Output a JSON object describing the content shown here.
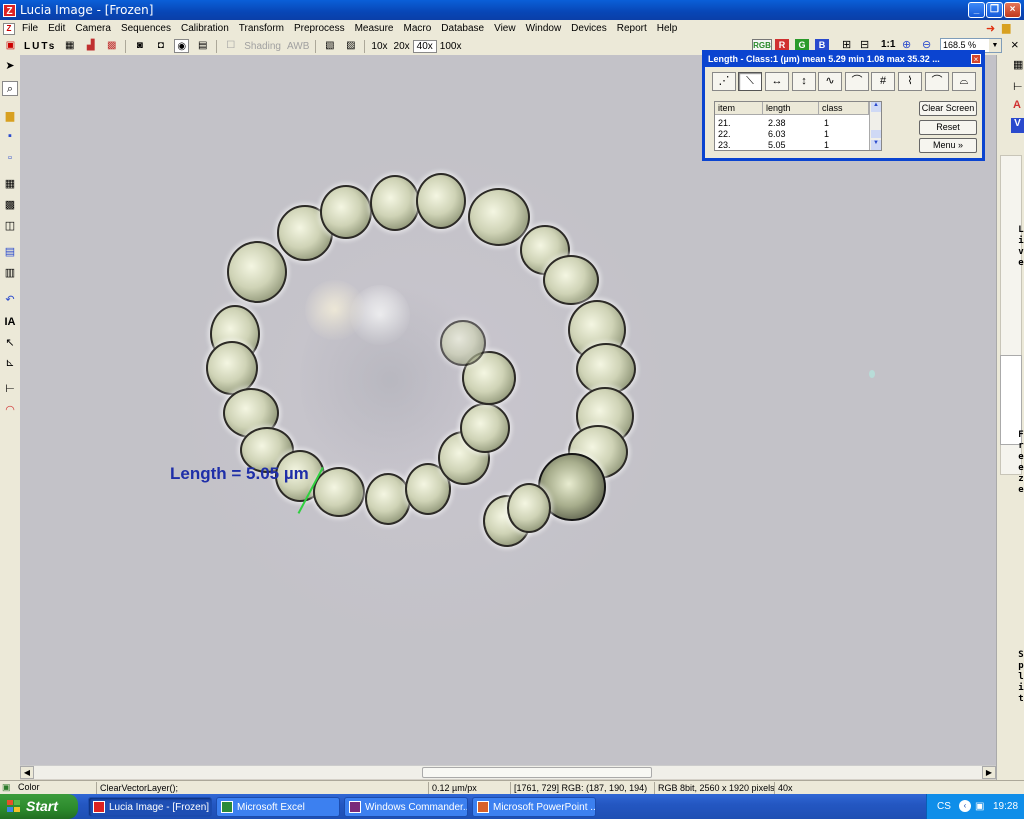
{
  "window": {
    "title": "Lucia Image  - [Frozen]",
    "app_icon": "lucia-z-icon"
  },
  "menu": [
    "File",
    "Edit",
    "Camera",
    "Sequences",
    "Calibration",
    "Transform",
    "Preprocess",
    "Measure",
    "Macro",
    "Database",
    "View",
    "Window",
    "Devices",
    "Report",
    "Help"
  ],
  "toolbar": {
    "luts_label": "LUTs",
    "shading_label": "Shading",
    "awb_label": "AWB",
    "magnifications": [
      "10x",
      "20x",
      "40x",
      "100x"
    ],
    "selected_magnification": "40x",
    "rgb_buttons": [
      "R",
      "G",
      "B"
    ],
    "zoom_ratio_label": "1:1",
    "zoom_value": "168.5 %"
  },
  "measure_window": {
    "title": "Length - Class:1  (µm)   mean 5.29  min 1.08  max 35.32  ...",
    "columns": [
      "item",
      "length",
      "class"
    ],
    "rows": [
      {
        "item": "21.",
        "length": "2.38",
        "class": "1"
      },
      {
        "item": "22.",
        "length": "6.03",
        "class": "1"
      },
      {
        "item": "23.",
        "length": "5.05",
        "class": "1"
      }
    ],
    "buttons": {
      "clear": "Clear Screen",
      "reset": "Reset",
      "menu": "Menu  »"
    }
  },
  "image": {
    "annotation": "Length = 5.05 µm",
    "annotation_color": "#1f2fa8",
    "background_color": "#c3c2c8"
  },
  "right_panel": {
    "live": "Live",
    "freeze": "Freeze",
    "split": "Split"
  },
  "status": {
    "mode": "Color",
    "command": "ClearVectorLayer();",
    "scale": "0.12 µm/px",
    "pixel": "[1761, 729] RGB: (187, 190, 194)",
    "image_info": "RGB 8bit, 2560 x 1920 pixels",
    "magnification": "40x"
  },
  "taskbar": {
    "start": "Start",
    "tasks": [
      "Lucia Image  - [Frozen]",
      "Microsoft Excel",
      "Windows Commander...",
      "Microsoft PowerPoint ..."
    ],
    "language": "CS",
    "clock": "19:28"
  }
}
